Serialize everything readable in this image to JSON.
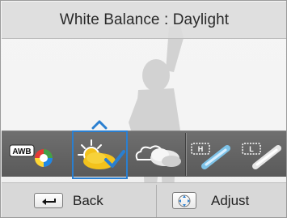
{
  "title": "White Balance : Daylight",
  "white_balance_options": [
    {
      "name": "Auto WB",
      "badge": "AWB",
      "selected": false
    },
    {
      "name": "Daylight",
      "selected": true
    },
    {
      "name": "Cloudy",
      "selected": false
    },
    {
      "name": "Fluorescent_H",
      "badge": "H",
      "selected": false
    },
    {
      "name": "Fluorescent_L",
      "badge": "L",
      "selected": false
    }
  ],
  "bottom_bar": {
    "back_label": "Back",
    "adjust_label": "Adjust"
  },
  "colors": {
    "selection": "#2a7fd0",
    "strip": "#636363",
    "bar": "#d8d8d8"
  }
}
